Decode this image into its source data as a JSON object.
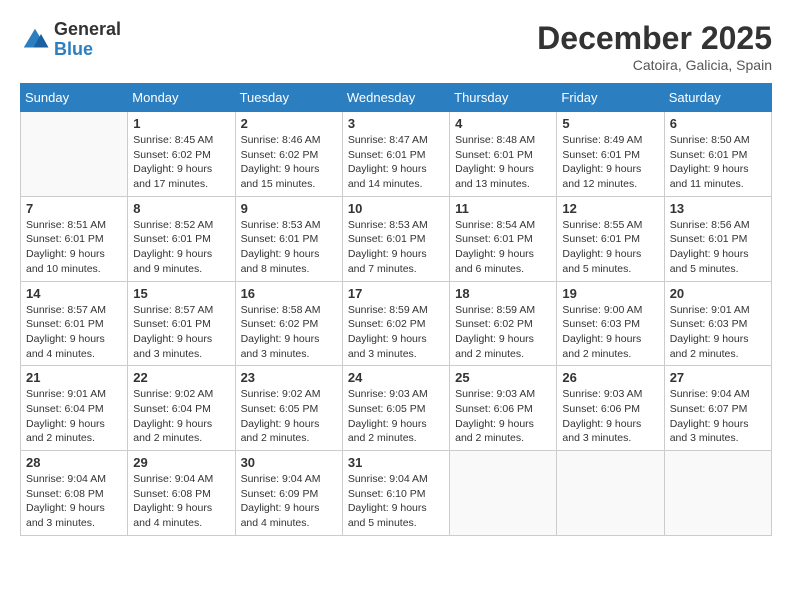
{
  "logo": {
    "general": "General",
    "blue": "Blue"
  },
  "title": {
    "month_year": "December 2025",
    "location": "Catoira, Galicia, Spain"
  },
  "weekdays": [
    "Sunday",
    "Monday",
    "Tuesday",
    "Wednesday",
    "Thursday",
    "Friday",
    "Saturday"
  ],
  "weeks": [
    [
      {
        "day": null
      },
      {
        "day": "1",
        "sunrise": "Sunrise: 8:45 AM",
        "sunset": "Sunset: 6:02 PM",
        "daylight": "Daylight: 9 hours and 17 minutes."
      },
      {
        "day": "2",
        "sunrise": "Sunrise: 8:46 AM",
        "sunset": "Sunset: 6:02 PM",
        "daylight": "Daylight: 9 hours and 15 minutes."
      },
      {
        "day": "3",
        "sunrise": "Sunrise: 8:47 AM",
        "sunset": "Sunset: 6:01 PM",
        "daylight": "Daylight: 9 hours and 14 minutes."
      },
      {
        "day": "4",
        "sunrise": "Sunrise: 8:48 AM",
        "sunset": "Sunset: 6:01 PM",
        "daylight": "Daylight: 9 hours and 13 minutes."
      },
      {
        "day": "5",
        "sunrise": "Sunrise: 8:49 AM",
        "sunset": "Sunset: 6:01 PM",
        "daylight": "Daylight: 9 hours and 12 minutes."
      },
      {
        "day": "6",
        "sunrise": "Sunrise: 8:50 AM",
        "sunset": "Sunset: 6:01 PM",
        "daylight": "Daylight: 9 hours and 11 minutes."
      }
    ],
    [
      {
        "day": "7",
        "sunrise": "Sunrise: 8:51 AM",
        "sunset": "Sunset: 6:01 PM",
        "daylight": "Daylight: 9 hours and 10 minutes."
      },
      {
        "day": "8",
        "sunrise": "Sunrise: 8:52 AM",
        "sunset": "Sunset: 6:01 PM",
        "daylight": "Daylight: 9 hours and 9 minutes."
      },
      {
        "day": "9",
        "sunrise": "Sunrise: 8:53 AM",
        "sunset": "Sunset: 6:01 PM",
        "daylight": "Daylight: 9 hours and 8 minutes."
      },
      {
        "day": "10",
        "sunrise": "Sunrise: 8:53 AM",
        "sunset": "Sunset: 6:01 PM",
        "daylight": "Daylight: 9 hours and 7 minutes."
      },
      {
        "day": "11",
        "sunrise": "Sunrise: 8:54 AM",
        "sunset": "Sunset: 6:01 PM",
        "daylight": "Daylight: 9 hours and 6 minutes."
      },
      {
        "day": "12",
        "sunrise": "Sunrise: 8:55 AM",
        "sunset": "Sunset: 6:01 PM",
        "daylight": "Daylight: 9 hours and 5 minutes."
      },
      {
        "day": "13",
        "sunrise": "Sunrise: 8:56 AM",
        "sunset": "Sunset: 6:01 PM",
        "daylight": "Daylight: 9 hours and 5 minutes."
      }
    ],
    [
      {
        "day": "14",
        "sunrise": "Sunrise: 8:57 AM",
        "sunset": "Sunset: 6:01 PM",
        "daylight": "Daylight: 9 hours and 4 minutes."
      },
      {
        "day": "15",
        "sunrise": "Sunrise: 8:57 AM",
        "sunset": "Sunset: 6:01 PM",
        "daylight": "Daylight: 9 hours and 3 minutes."
      },
      {
        "day": "16",
        "sunrise": "Sunrise: 8:58 AM",
        "sunset": "Sunset: 6:02 PM",
        "daylight": "Daylight: 9 hours and 3 minutes."
      },
      {
        "day": "17",
        "sunrise": "Sunrise: 8:59 AM",
        "sunset": "Sunset: 6:02 PM",
        "daylight": "Daylight: 9 hours and 3 minutes."
      },
      {
        "day": "18",
        "sunrise": "Sunrise: 8:59 AM",
        "sunset": "Sunset: 6:02 PM",
        "daylight": "Daylight: 9 hours and 2 minutes."
      },
      {
        "day": "19",
        "sunrise": "Sunrise: 9:00 AM",
        "sunset": "Sunset: 6:03 PM",
        "daylight": "Daylight: 9 hours and 2 minutes."
      },
      {
        "day": "20",
        "sunrise": "Sunrise: 9:01 AM",
        "sunset": "Sunset: 6:03 PM",
        "daylight": "Daylight: 9 hours and 2 minutes."
      }
    ],
    [
      {
        "day": "21",
        "sunrise": "Sunrise: 9:01 AM",
        "sunset": "Sunset: 6:04 PM",
        "daylight": "Daylight: 9 hours and 2 minutes."
      },
      {
        "day": "22",
        "sunrise": "Sunrise: 9:02 AM",
        "sunset": "Sunset: 6:04 PM",
        "daylight": "Daylight: 9 hours and 2 minutes."
      },
      {
        "day": "23",
        "sunrise": "Sunrise: 9:02 AM",
        "sunset": "Sunset: 6:05 PM",
        "daylight": "Daylight: 9 hours and 2 minutes."
      },
      {
        "day": "24",
        "sunrise": "Sunrise: 9:03 AM",
        "sunset": "Sunset: 6:05 PM",
        "daylight": "Daylight: 9 hours and 2 minutes."
      },
      {
        "day": "25",
        "sunrise": "Sunrise: 9:03 AM",
        "sunset": "Sunset: 6:06 PM",
        "daylight": "Daylight: 9 hours and 2 minutes."
      },
      {
        "day": "26",
        "sunrise": "Sunrise: 9:03 AM",
        "sunset": "Sunset: 6:06 PM",
        "daylight": "Daylight: 9 hours and 3 minutes."
      },
      {
        "day": "27",
        "sunrise": "Sunrise: 9:04 AM",
        "sunset": "Sunset: 6:07 PM",
        "daylight": "Daylight: 9 hours and 3 minutes."
      }
    ],
    [
      {
        "day": "28",
        "sunrise": "Sunrise: 9:04 AM",
        "sunset": "Sunset: 6:08 PM",
        "daylight": "Daylight: 9 hours and 3 minutes."
      },
      {
        "day": "29",
        "sunrise": "Sunrise: 9:04 AM",
        "sunset": "Sunset: 6:08 PM",
        "daylight": "Daylight: 9 hours and 4 minutes."
      },
      {
        "day": "30",
        "sunrise": "Sunrise: 9:04 AM",
        "sunset": "Sunset: 6:09 PM",
        "daylight": "Daylight: 9 hours and 4 minutes."
      },
      {
        "day": "31",
        "sunrise": "Sunrise: 9:04 AM",
        "sunset": "Sunset: 6:10 PM",
        "daylight": "Daylight: 9 hours and 5 minutes."
      },
      {
        "day": null
      },
      {
        "day": null
      },
      {
        "day": null
      }
    ]
  ]
}
